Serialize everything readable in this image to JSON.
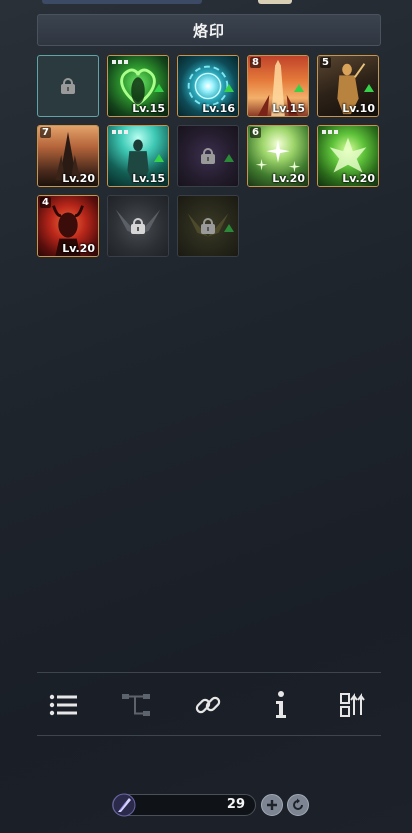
{
  "header": {
    "title": "烙印"
  },
  "slots": [
    {
      "kind": "selected-locked"
    },
    {
      "kind": "skill",
      "name": "green-heart-figure",
      "level": "Lv.15",
      "pips": 3,
      "upgrade": true
    },
    {
      "kind": "skill",
      "name": "cyan-vortex",
      "level": "Lv.16",
      "upgrade": true
    },
    {
      "kind": "skill",
      "name": "flame-pillar",
      "level": "Lv.15",
      "count": "8",
      "upgrade": true
    },
    {
      "kind": "skill",
      "name": "golden-warrior",
      "level": "Lv.10",
      "count": "5",
      "upgrade": true
    },
    {
      "kind": "skill",
      "name": "obsidian-spire",
      "level": "Lv.20",
      "count": "7"
    },
    {
      "kind": "skill",
      "name": "teal-armored-knight",
      "level": "Lv.15",
      "pips": 3,
      "upgrade": true
    },
    {
      "kind": "locked",
      "name": "violet-sigil",
      "upgrade": true
    },
    {
      "kind": "skill",
      "name": "green-sparkles",
      "level": "Lv.20",
      "count": "6"
    },
    {
      "kind": "skill",
      "name": "emerald-crest",
      "level": "Lv.20",
      "pips": 3
    },
    {
      "kind": "skill",
      "name": "crimson-demon",
      "level": "Lv.20",
      "count": "4"
    },
    {
      "kind": "locked",
      "name": "grey-wings"
    },
    {
      "kind": "locked",
      "name": "olive-wings",
      "upgrade": true
    }
  ],
  "toolbar": {
    "buttons": [
      "list-icon",
      "tree-icon",
      "link-icon",
      "info-icon",
      "sort-icon"
    ]
  },
  "currency": {
    "value": "29",
    "icon": "feather-crystal-icon"
  },
  "colors": {
    "gold_border": "#c9954a",
    "upgrade_arrow": "#35d24a",
    "selected_border": "#5fa5a8"
  }
}
